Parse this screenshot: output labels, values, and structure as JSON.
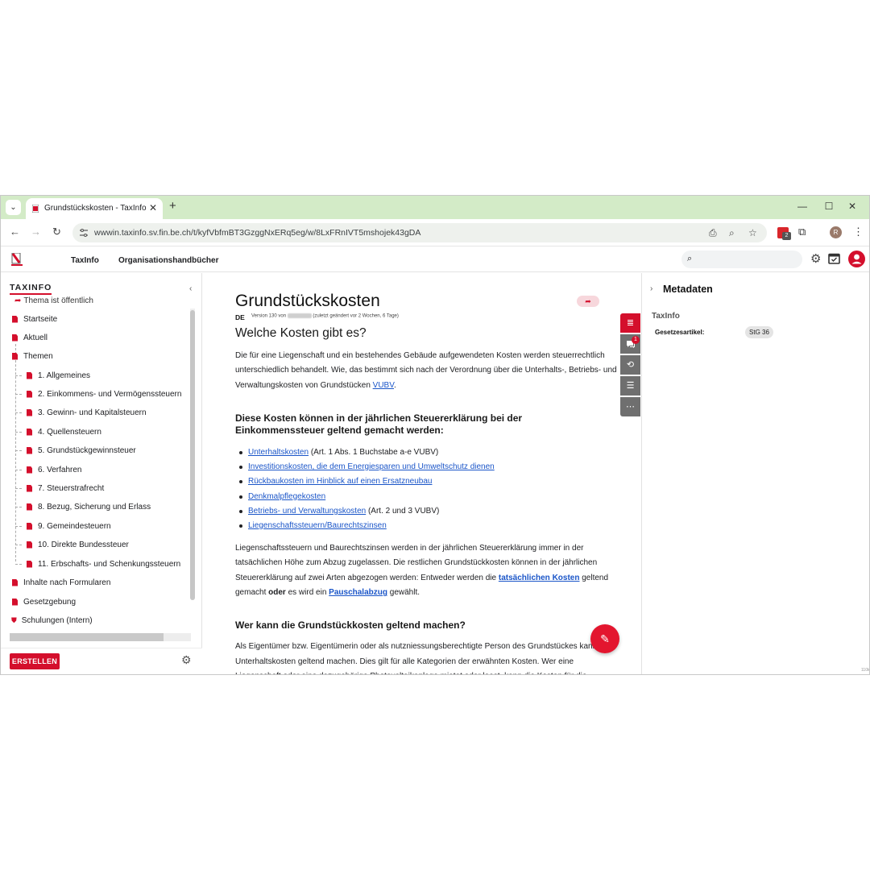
{
  "browser": {
    "tab_title": "Grundstückskosten - TaxInfo",
    "tab_close": "✕",
    "new_tab": "+",
    "url": "wwwin.taxinfo.sv.fin.be.ch/t/kyfVbfmBT3GzggNxERq5eg/w/8LxFRnIVT5mshojek43gDA",
    "extension_badge": "2",
    "profile_initial": "R",
    "window_controls": [
      "—",
      "☐",
      "✕"
    ]
  },
  "app": {
    "nav": [
      "TaxInfo",
      "Organisationshandbücher"
    ],
    "search_placeholder": "",
    "accent_color": "#d40f2c"
  },
  "sidebar": {
    "title": "TAXINFO",
    "public_flag": "Thema ist öffentlich",
    "items": [
      {
        "label": "Startseite",
        "level": 0
      },
      {
        "label": "Aktuell",
        "level": 0
      },
      {
        "label": "Themen",
        "level": 0
      },
      {
        "label": "1. Allgemeines",
        "level": 1
      },
      {
        "label": "2. Einkommens- und Vermögenssteuern",
        "level": 1
      },
      {
        "label": "3. Gewinn- und Kapitalsteuern",
        "level": 1
      },
      {
        "label": "4. Quellensteuern",
        "level": 1
      },
      {
        "label": "5. Grundstückgewinnsteuer",
        "level": 1
      },
      {
        "label": "6. Verfahren",
        "level": 1
      },
      {
        "label": "7. Steuerstrafrecht",
        "level": 1
      },
      {
        "label": "8. Bezug, Sicherung und Erlass",
        "level": 1
      },
      {
        "label": "9. Gemeindesteuern",
        "level": 1
      },
      {
        "label": "10. Direkte Bundessteuer",
        "level": 1
      },
      {
        "label": "11. Erbschafts- und Schenkungssteuern",
        "level": 1
      },
      {
        "label": "Inhalte nach Formularen",
        "level": 0
      },
      {
        "label": "Gesetzgebung",
        "level": 0
      },
      {
        "label": "Schulungen (Intern)",
        "level": 0,
        "icon": "shield"
      }
    ],
    "create_label": "ERSTELLEN"
  },
  "main": {
    "title": "Grundstückskosten",
    "lang": "DE",
    "version_prefix": "Version 130 von",
    "version_suffix": "(zuletzt geändert vor 2 Wochen, 6 Tage)",
    "h2": "Welche Kosten gibt es?",
    "intro_1": "Die für eine Liegenschaft und ein bestehendes Gebäude aufgewendeten Kosten werden steuerrechtlich unterschiedlich behandelt. Wie, das bestimmt sich nach der Verordnung über die Unterhalts-, Betriebs- und Verwaltungskosten von Grundstücken ",
    "intro_link": "VUBV",
    "intro_end": ".",
    "h3_1": "Diese Kosten können in der jährlichen Steuererklärung bei der Einkommenssteuer geltend gemacht werden:",
    "list": [
      {
        "link": "Unterhaltskosten",
        "text": " (Art. 1 Abs. 1 Buchstabe a-e VUBV)"
      },
      {
        "link": "Investitionskosten, die dem Energiesparen und Umweltschutz dienen",
        "text": ""
      },
      {
        "link": "Rückbaukosten im Hinblick auf einen Ersatzneubau",
        "text": ""
      },
      {
        "link": "Denkmalpflegekosten",
        "text": ""
      },
      {
        "link": "Betriebs- und Verwaltungskosten",
        "text": " (Art. 2 und 3 VUBV)"
      },
      {
        "link": "Liegenschaftssteuern/Baurechtszinsen",
        "text": ""
      }
    ],
    "para2_a": "Liegenschaftssteuern und Baurechtszinsen werden in der jährlichen Steuererklärung immer in der tatsächlichen Höhe zum Abzug zugelassen. Die restlichen Grundstückkosten können in der jährlichen Steuererklärung auf zwei Arten abgezogen werden: Entweder werden die ",
    "para2_link1": "tatsächlichen Kosten",
    "para2_b": " geltend gemacht ",
    "para2_bold": "oder",
    "para2_c": " es wird ein ",
    "para2_link2": "Pauschalabzug",
    "para2_d": " gewählt.",
    "h3_2": "Wer kann die Grundstückkosten geltend machen?",
    "para3": "Als Eigentümer bzw. Eigentümerin oder als nutzniessungsberechtigte Person des Grundstückes kann Sie Unterhaltskosten geltend machen. Dies gilt für alle Kategorien der erwähnten Kosten. Wer eine Liegenschaft oder eine dazugehörige Photovoltaikanlage mietet oder least, kann die Kosten für die",
    "comment_count": "1"
  },
  "meta": {
    "title": "Metadaten",
    "section": "TaxInfo",
    "key": "Gesetzesartikel:",
    "chip": "StG 36",
    "corner": "110k"
  }
}
